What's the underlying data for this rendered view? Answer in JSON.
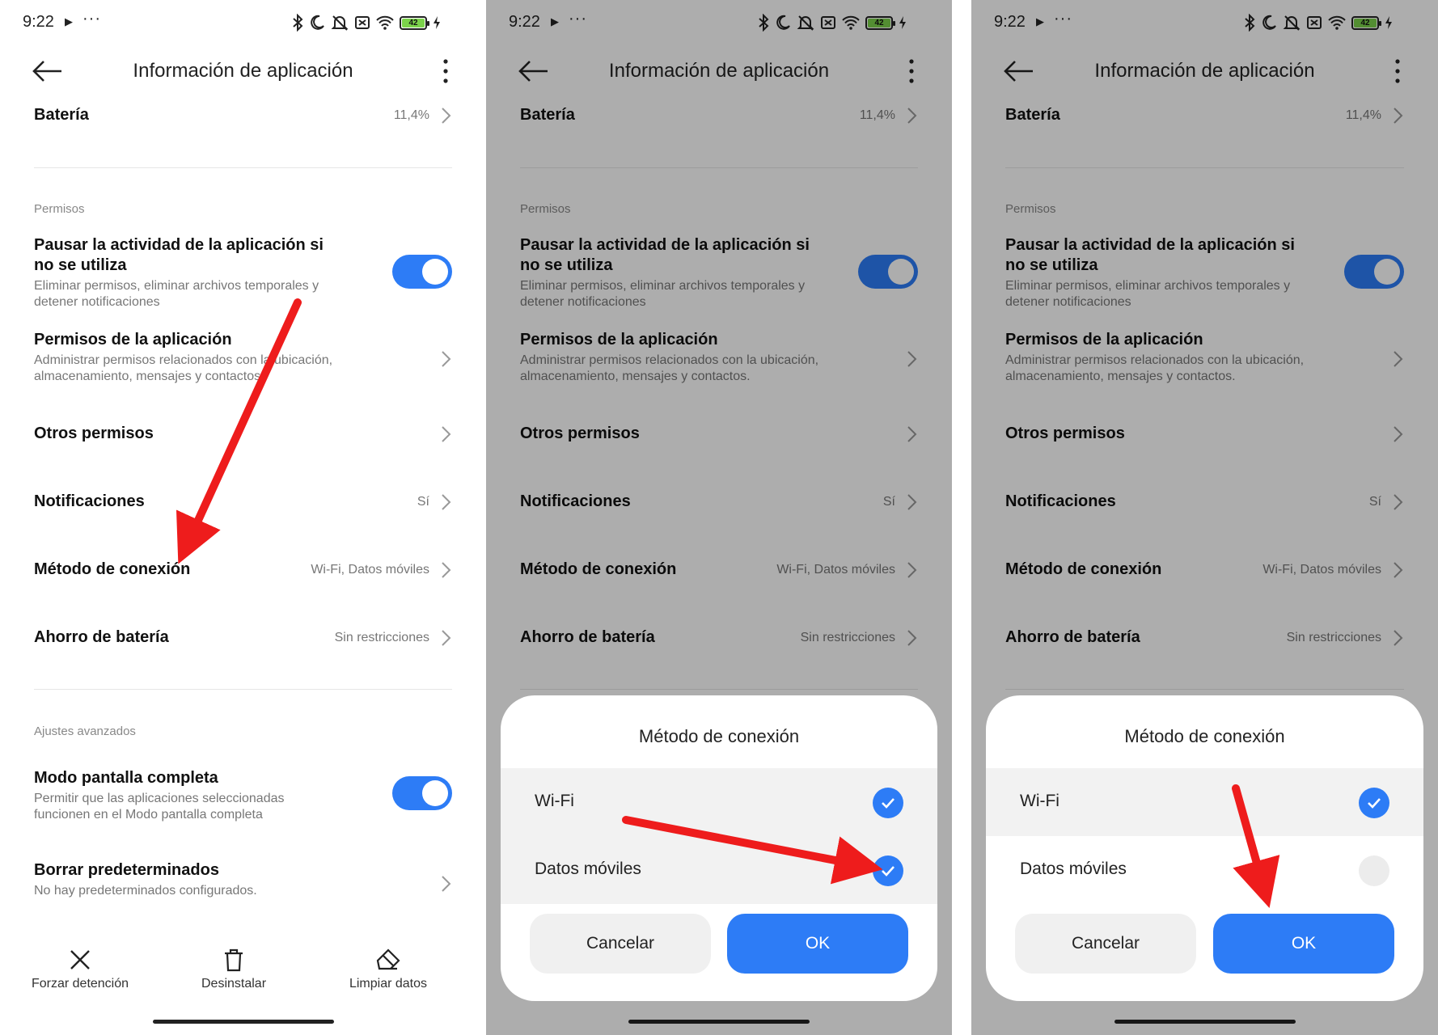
{
  "colors": {
    "accent": "#2d7cf6",
    "arrow": "#ee1c1c",
    "battery": "#7bd24a"
  },
  "statusbar": {
    "time": "9:22",
    "battery_level": "42",
    "icons": [
      "play-icon",
      "more-dots-icon",
      "bluetooth-icon",
      "moon-icon",
      "mute-icon",
      "dismiss-icon",
      "wifi-icon",
      "battery-icon",
      "charging-icon"
    ]
  },
  "appbar": {
    "title": "Información de aplicación"
  },
  "settings": {
    "battery": {
      "title": "Batería",
      "value": "11,4%"
    },
    "permissions_section": "Permisos",
    "pause_activity": {
      "title_line1": "Pausar la actividad de la aplicación si",
      "title_line2": "no se utiliza",
      "sub_line1": "Eliminar permisos, eliminar archivos temporales y",
      "sub_line2": "detener notificaciones",
      "enabled": true
    },
    "app_permissions": {
      "title": "Permisos de la aplicación",
      "sub_line1": "Administrar permisos relacionados con la ubicación,",
      "sub_line2": "almacenamiento, mensajes y contactos."
    },
    "other_permissions": {
      "title": "Otros permisos"
    },
    "notifications": {
      "title": "Notificaciones",
      "value": "Sí"
    },
    "connection_method": {
      "title": "Método de conexión",
      "value": "Wi-Fi, Datos móviles"
    },
    "battery_saver": {
      "title": "Ahorro de batería",
      "value": "Sin restricciones"
    },
    "advanced_section": "Ajustes avanzados",
    "fullscreen_mode": {
      "title": "Modo pantalla completa",
      "sub_line1": "Permitir que las aplicaciones seleccionadas",
      "sub_line2": "funcionen en el Modo pantalla completa",
      "enabled": true
    },
    "clear_defaults": {
      "title": "Borrar predeterminados",
      "sub": "No hay predeterminados configurados."
    }
  },
  "bottom_actions": {
    "force_stop": "Forzar detención",
    "uninstall": "Desinstalar",
    "clear_data": "Limpiar datos"
  },
  "dialog": {
    "title": "Método de conexión",
    "options": [
      {
        "label": "Wi-Fi"
      },
      {
        "label": "Datos móviles"
      }
    ],
    "cancel": "Cancelar",
    "ok": "OK"
  },
  "screens": [
    {
      "id": "screen1",
      "dialog": false
    },
    {
      "id": "screen2",
      "dialog": true,
      "wifi_checked": true,
      "mobile_checked": true
    },
    {
      "id": "screen3",
      "dialog": true,
      "wifi_checked": true,
      "mobile_checked": false
    }
  ]
}
